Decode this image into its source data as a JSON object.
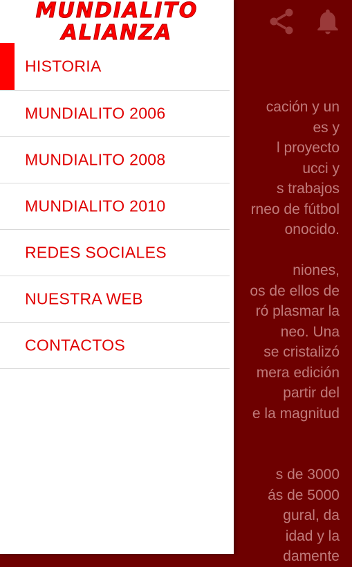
{
  "logo": {
    "line1": "MUNDIALITO",
    "line2": "ALIANZA"
  },
  "toolbar": {
    "share_icon": "share-icon",
    "bell_icon": "bell-icon"
  },
  "menu": {
    "items": [
      {
        "label": "HISTORIA",
        "active": true
      },
      {
        "label": "MUNDIALITO 2006",
        "active": false
      },
      {
        "label": "MUNDIALITO 2008",
        "active": false
      },
      {
        "label": "MUNDIALITO 2010",
        "active": false
      },
      {
        "label": "REDES SOCIALES",
        "active": false
      },
      {
        "label": "NUESTRA WEB",
        "active": false
      },
      {
        "label": "CONTACTOS",
        "active": false
      }
    ]
  },
  "background_text": {
    "lines": [
      "cación y un",
      "es y",
      "l proyecto",
      "ucci y",
      "s trabajos",
      "rneo de fútbol",
      "onocido.",
      "",
      "niones,",
      "os de ellos de",
      "ró plasmar la",
      "neo. Una",
      "se cristalizó",
      "mera edición",
      "partir del",
      "e la magnitud",
      "",
      "",
      "s de 3000",
      "ás de 5000",
      "gural, da",
      "idad y la",
      "damente"
    ]
  },
  "colors": {
    "accent": "#ff0000",
    "menu_text": "#e00000",
    "app_background": "#6e0000"
  }
}
